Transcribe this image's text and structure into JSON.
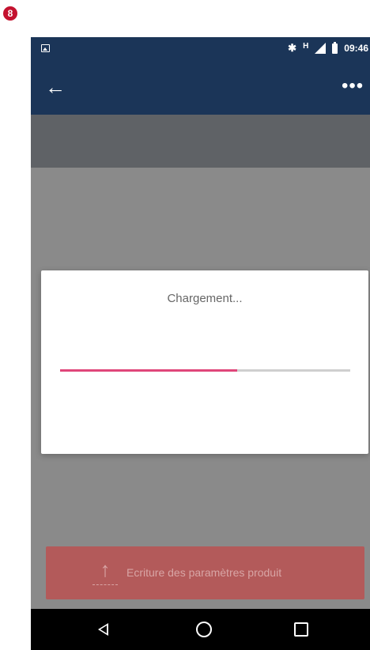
{
  "step_badge": "8",
  "status_bar": {
    "icons": [
      "image-icon",
      "bluetooth-icon",
      "h-network-icon",
      "signal-icon",
      "battery-icon"
    ],
    "network_label": "H",
    "time": "09:46"
  },
  "app_bar": {
    "icons": [
      "back-arrow-icon",
      "more-options-icon"
    ]
  },
  "dialog": {
    "title": "Chargement...",
    "progress": 0.61,
    "progress_color": "#e0467a"
  },
  "action_button": {
    "icon": "upload-arrow-icon",
    "label": "Ecriture des paramètres produit"
  },
  "nav_bar": {
    "icons": [
      "back-triangle-icon",
      "home-circle-icon",
      "recents-square-icon"
    ]
  },
  "colors": {
    "app_bar": "#1b3558",
    "overlay": "#8a8a8a",
    "action_button": "#b35a5a"
  }
}
